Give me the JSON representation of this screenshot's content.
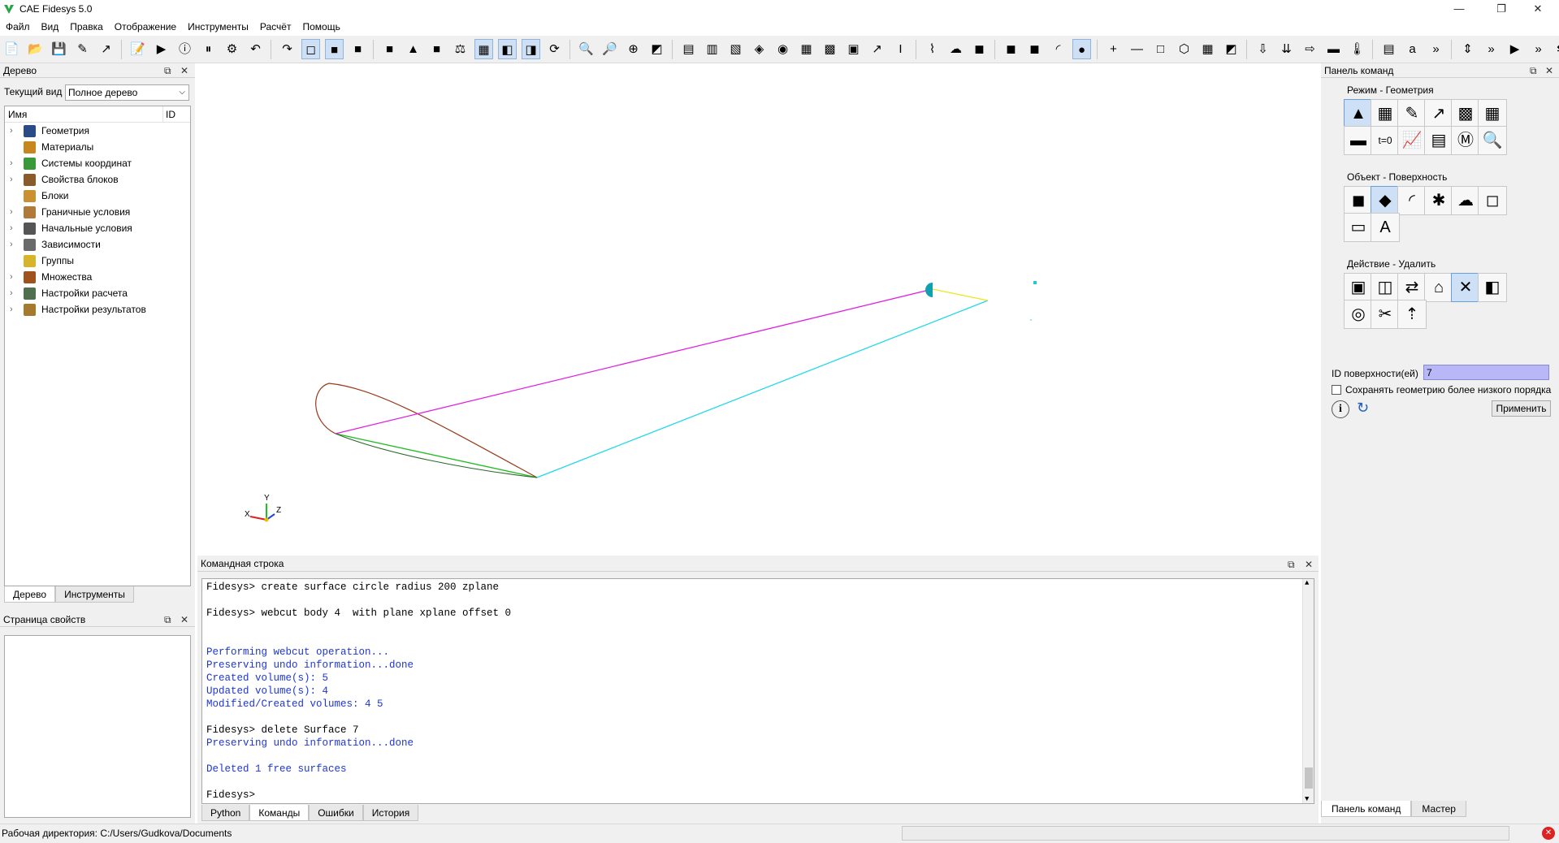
{
  "window": {
    "title": "CAE Fidesys 5.0",
    "minimize": "—",
    "maximize": "❐",
    "close": "✕"
  },
  "menu": [
    "Файл",
    "Вид",
    "Правка",
    "Отображение",
    "Инструменты",
    "Расчёт",
    "Помощь"
  ],
  "toolbar_icons": [
    "📄",
    "📂",
    "💾",
    "✎",
    "↗",
    "📝",
    "▶",
    "ⓘ",
    "⏸",
    "⚙",
    "↶",
    "↷",
    "◻",
    "■",
    "■",
    "■",
    "▲",
    "■",
    "⚖",
    "▦",
    "◧",
    "◨",
    "⟳",
    "🔍",
    "🔎",
    "⊕",
    "◩",
    "▤",
    "▥",
    "▧",
    "◈",
    "◉",
    "▦",
    "▩",
    "▣",
    "↗",
    "I",
    "⌇",
    "☁",
    "◼",
    "◼",
    "◼",
    "◜",
    "●",
    "+",
    "—",
    "□",
    "⬡",
    "▦",
    "◩",
    "⇩",
    "⇊",
    "⇨",
    "▬",
    "🌡",
    "▤",
    "a",
    "»",
    "⇕",
    "»",
    "▶",
    "»",
    "⇆"
  ],
  "tree_panel": {
    "title": "Дерево",
    "view_label": "Текущий вид",
    "view_value": "Полное дерево",
    "col_name": "Имя",
    "col_id": "ID",
    "items": [
      {
        "label": "Геометрия",
        "color": "#2b4a88",
        "expandable": true
      },
      {
        "label": "Материалы",
        "color": "#c8861e",
        "expandable": false
      },
      {
        "label": "Системы координат",
        "color": "#3a9a3a",
        "expandable": true
      },
      {
        "label": "Свойства блоков",
        "color": "#8b5a2b",
        "expandable": true
      },
      {
        "label": "Блоки",
        "color": "#c9912f",
        "expandable": false
      },
      {
        "label": "Граничные условия",
        "color": "#b07a3a",
        "expandable": true
      },
      {
        "label": "Начальные условия",
        "color": "#555555",
        "expandable": true
      },
      {
        "label": "Зависимости",
        "color": "#6a6a6a",
        "expandable": true
      },
      {
        "label": "Группы",
        "color": "#d8b42a",
        "expandable": false
      },
      {
        "label": "Множества",
        "color": "#a0521e",
        "expandable": true
      },
      {
        "label": "Настройки расчета",
        "color": "#4f6f4f",
        "expandable": true
      },
      {
        "label": "Настройки результатов",
        "color": "#a5792e",
        "expandable": true
      }
    ],
    "tabs": [
      "Дерево",
      "Инструменты"
    ]
  },
  "props_panel": {
    "title": "Страница свойств"
  },
  "command_panel": {
    "title": "Командная строка",
    "lines": [
      {
        "text": "Fidesys> create surface circle radius 200 zplane",
        "type": "cmd"
      },
      {
        "text": "",
        "type": "out"
      },
      {
        "text": "Fidesys> webcut body 4  with plane xplane offset 0",
        "type": "cmd"
      },
      {
        "text": "",
        "type": "out"
      },
      {
        "text": "",
        "type": "out"
      },
      {
        "text": "Performing webcut operation...",
        "type": "out"
      },
      {
        "text": "Preserving undo information...done",
        "type": "out"
      },
      {
        "text": "Created volume(s): 5",
        "type": "out"
      },
      {
        "text": "Updated volume(s): 4",
        "type": "out"
      },
      {
        "text": "Modified/Created volumes: 4 5",
        "type": "out"
      },
      {
        "text": "",
        "type": "out"
      },
      {
        "text": "Fidesys> delete Surface 7",
        "type": "cmd"
      },
      {
        "text": "Preserving undo information...done",
        "type": "out"
      },
      {
        "text": "",
        "type": "out"
      },
      {
        "text": "Deleted 1 free surfaces",
        "type": "out"
      },
      {
        "text": "",
        "type": "out"
      },
      {
        "text": "Fidesys> ",
        "type": "cmd"
      }
    ],
    "tabs": [
      "Python",
      "Команды",
      "Ошибки",
      "История"
    ]
  },
  "right_panel": {
    "title": "Панель команд",
    "mode_label": "Режим - Геометрия",
    "object_label": "Объект - Поверхность",
    "action_label": "Действие - Удалить",
    "mode_icons": [
      "▲",
      "▦",
      "✎",
      "↗",
      "▩",
      "▦",
      "▬",
      "t=0",
      "📈",
      "▤",
      "Ⓜ",
      "🔍"
    ],
    "object_icons": [
      "◼",
      "◆",
      "◜",
      "✱",
      "☁",
      "◻",
      "▭",
      "A"
    ],
    "action_icons": [
      "▣",
      "◫",
      "⇄",
      "⌂",
      "✕",
      "◧",
      "◎",
      "✂",
      "⇡"
    ],
    "id_label": "ID поверхности(ей)",
    "id_value": "7",
    "keep_label": "Сохранять геометрию более низкого порядка",
    "apply_label": "Применить",
    "tabs": [
      "Панель команд",
      "Мастер"
    ]
  },
  "statusbar": {
    "workdir": "Рабочая директория: C:/Users/Gudkova/Documents"
  },
  "axes": {
    "x": "X",
    "y": "Y",
    "z": "Z"
  }
}
